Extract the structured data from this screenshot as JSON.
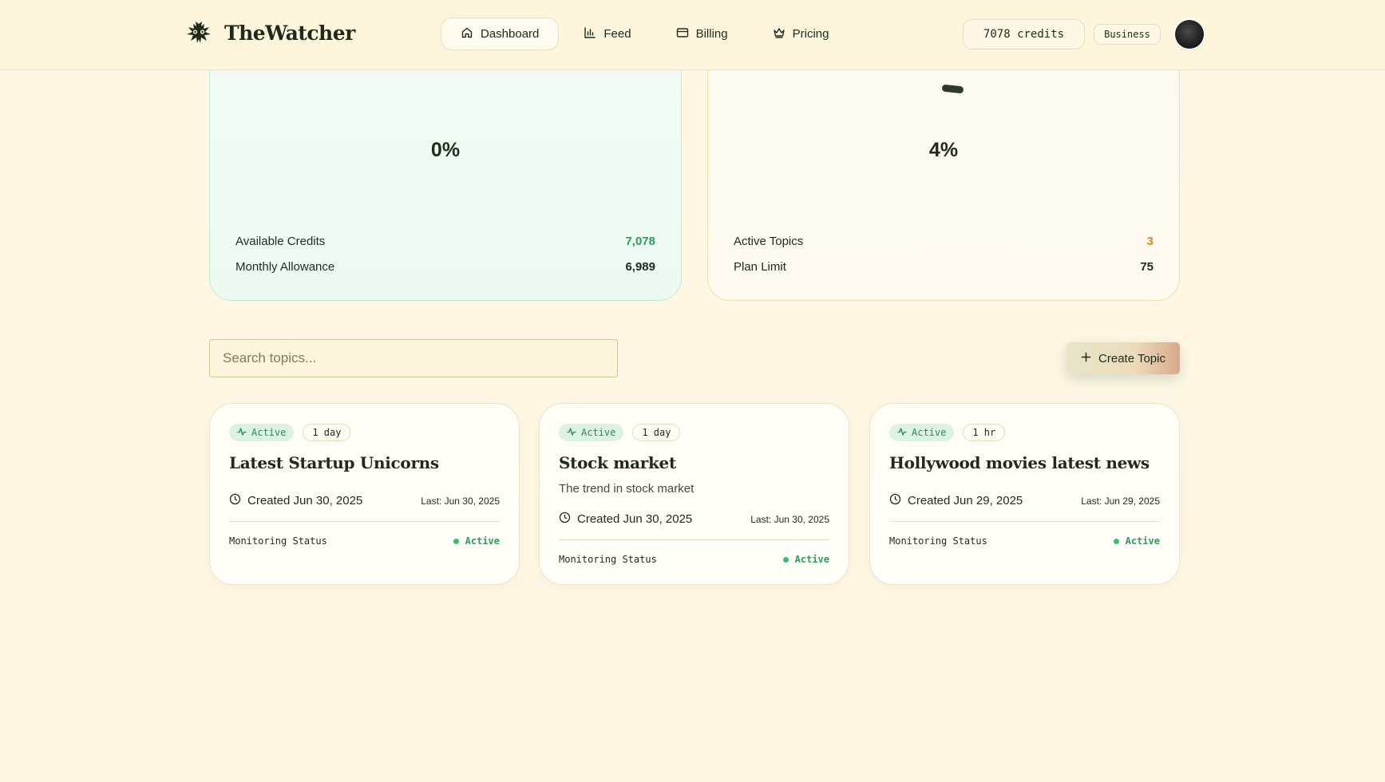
{
  "header": {
    "brand": "TheWatcher",
    "nav": [
      {
        "label": "Dashboard",
        "icon": "home-icon",
        "active": true
      },
      {
        "label": "Feed",
        "icon": "bar-chart-icon",
        "active": false
      },
      {
        "label": "Billing",
        "icon": "credit-card-icon",
        "active": false
      },
      {
        "label": "Pricing",
        "icon": "crown-icon",
        "active": false
      }
    ],
    "credits": "7078 credits",
    "plan": "Business"
  },
  "stats": {
    "credits_card": {
      "percent": "0%",
      "rows": [
        {
          "label": "Available Credits",
          "value": "7,078"
        },
        {
          "label": "Monthly Allowance",
          "value": "6,989"
        }
      ]
    },
    "topics_card": {
      "percent": "4%",
      "rows": [
        {
          "label": "Active Topics",
          "value": "3"
        },
        {
          "label": "Plan Limit",
          "value": "75"
        }
      ]
    }
  },
  "toolbar": {
    "search_placeholder": "Search topics...",
    "create_label": "Create Topic"
  },
  "topics": [
    {
      "status": "Active",
      "interval": "1 day",
      "title": "Latest Startup Unicorns",
      "description": "",
      "created": "Created Jun 30, 2025",
      "last": "Last: Jun 30, 2025",
      "monitoring_label": "Monitoring Status",
      "monitoring_value": "Active"
    },
    {
      "status": "Active",
      "interval": "1 day",
      "title": "Stock market",
      "description": "The trend in stock market",
      "created": "Created Jun 30, 2025",
      "last": "Last: Jun 30, 2025",
      "monitoring_label": "Monitoring Status",
      "monitoring_value": "Active"
    },
    {
      "status": "Active",
      "interval": "1 hr",
      "title": "Hollywood movies latest news",
      "description": "",
      "created": "Created Jun 29, 2025",
      "last": "Last: Jun 29, 2025",
      "monitoring_label": "Monitoring Status",
      "monitoring_value": "Active"
    }
  ],
  "colors": {
    "background": "#fef7e3",
    "accent_green": "#2f9d5e",
    "accent_orange": "#d68a2a",
    "text": "#1f2a1c"
  }
}
